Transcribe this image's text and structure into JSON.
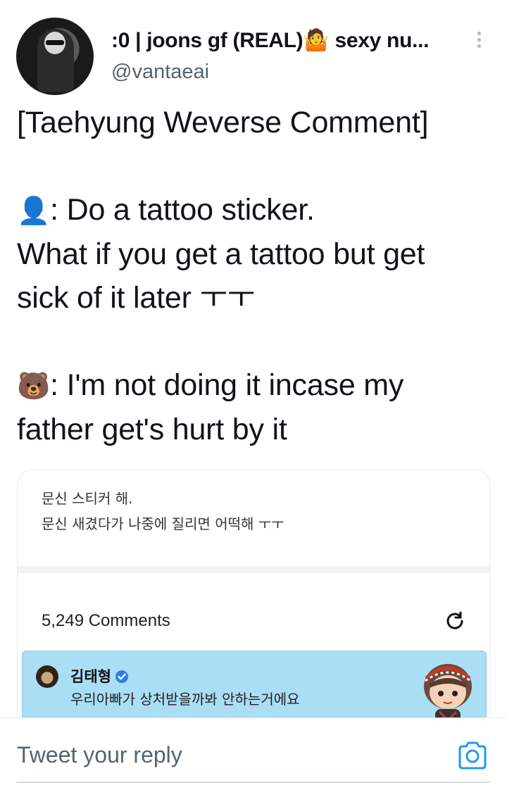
{
  "author": {
    "display_name": ":0 | joons gf (REAL)",
    "name_emoji": "🤷",
    "name_suffix": " sexy nu...",
    "handle": "@vantaeai"
  },
  "tweet": {
    "line1": "[Taehyung Weverse Comment]",
    "q_emoji": "👤",
    "q_line1": ": Do a tattoo sticker.",
    "q_line2": "What if you get a tattoo but get",
    "q_line3": "sick of it later ㅜㅜ",
    "a_emoji": "🐻",
    "a_line1": ": I'm not doing it incase my",
    "a_line2": "father get's hurt by it"
  },
  "weverse_card": {
    "post_line1": "문신 스티커 해.",
    "post_line2": "문신 새겼다가 나중에 질리면 어떡해 ㅜㅜ",
    "comments_count": "5,249 Comments",
    "comment": {
      "author": "김태형",
      "text": "우리아빠가 상처받을까봐 안하는거에요"
    }
  },
  "reply": {
    "placeholder": "Tweet your reply"
  },
  "colors": {
    "text_primary": "#0f1419",
    "text_secondary": "#536471",
    "twitter_blue": "#1d9bf0",
    "comment_highlight": "#a9def5"
  },
  "icons": {
    "more": "vertical-dots-icon",
    "refresh": "refresh-icon",
    "verified": "verified-badge-icon",
    "camera": "camera-icon"
  }
}
